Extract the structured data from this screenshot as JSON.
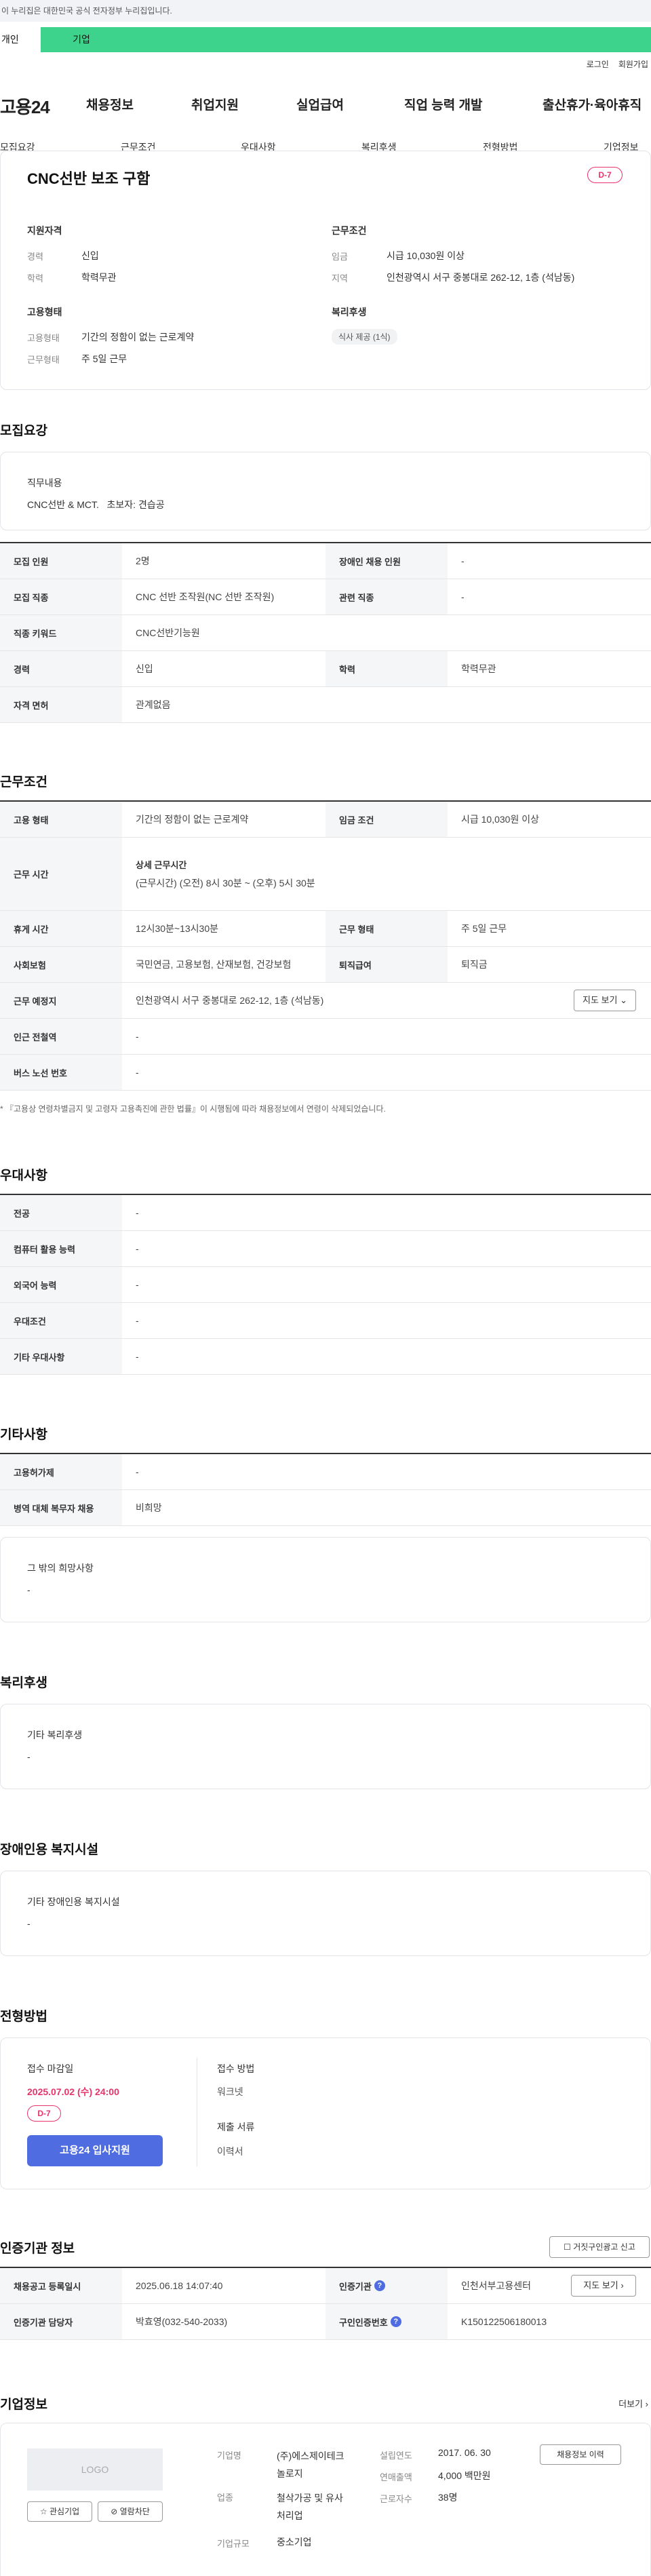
{
  "topbar": {
    "notice": "이 누리집은 대한민국 공식 전자정부 누리집입니다."
  },
  "usertabs": {
    "individual": "개인",
    "company": "기업"
  },
  "util": {
    "login": "로그인",
    "join": "회원가입"
  },
  "header": {
    "logo": "고용24",
    "gnb": [
      "채용정보",
      "취업지원",
      "실업급여",
      "직업 능력 개발",
      "출산휴가·육아휴직"
    ]
  },
  "subnav": [
    "모집요강",
    "근무조건",
    "우대사항",
    "복리후생",
    "전형방법",
    "기업정보"
  ],
  "summary": {
    "title": "CNC선반 보조 구함",
    "dday": "D-7",
    "qual_title": "지원자격",
    "cond_title": "근무조건",
    "qual": [
      {
        "label": "경력",
        "value": "신입"
      },
      {
        "label": "학력",
        "value": "학력무관"
      }
    ],
    "cond": [
      {
        "label": "임금",
        "value": "시급 10,030원 이상"
      },
      {
        "label": "지역",
        "value": "인천광역시 서구 중봉대로 262-12, 1층 (석남동)"
      }
    ],
    "emp_title": "고용형태",
    "welfare_title": "복리후생",
    "emp": [
      {
        "label": "고용형태",
        "value": "기간의 정함이 없는 근로계약"
      },
      {
        "label": "근무형태",
        "value": "주 5일 근무"
      }
    ],
    "welfare_chip": "식사 제공 (1식)"
  },
  "recruit": {
    "title": "모집요강",
    "duty_label": "직무내용",
    "duty_value": "CNC선반 & MCT.   초보자: 견습공",
    "rows": [
      {
        "h1": "모집 인원",
        "v1": "2명",
        "h2": "장애인 채용 인원",
        "v2": "-"
      },
      {
        "h1": "모집 직종",
        "v1": "CNC 선반 조작원(NC 선반 조작원)",
        "h2": "관련 직종",
        "v2": "-"
      },
      {
        "h1": "직종 키워드",
        "v1": "CNC선반기능원"
      },
      {
        "h1": "경력",
        "v1": "신입",
        "h2": "학력",
        "v2": "학력무관"
      },
      {
        "h1": "자격 면허",
        "v1": "관계없음"
      }
    ]
  },
  "work": {
    "title": "근무조건",
    "emp_h": "고용 형태",
    "emp_v": "기간의 정함이 없는 근로계약",
    "wage_h": "임금 조건",
    "wage_v": "시급 10,030원 이상",
    "time_h": "근무 시간",
    "time_sub": "상세 근무시간",
    "time_v": "(근무시간) (오전) 8시 30분 ~ (오후) 5시 30분",
    "rest_h": "휴게 시간",
    "rest_v": "12시30분~13시30분",
    "form_h": "근무 형태",
    "form_v": "주 5일 근무",
    "ins_h": "사회보험",
    "ins_v": "국민연금, 고용보험, 산재보험, 건강보험",
    "ret_h": "퇴직급여",
    "ret_v": "퇴직금",
    "place_h": "근무 예정지",
    "place_v": "인천광역시 서구 중봉대로 262-12, 1층 (석남동)",
    "map_btn": "지도 보기",
    "sub_h": "인근 전철역",
    "sub_v": "-",
    "bus_h": "버스 노선 번호",
    "bus_v": "-",
    "note": "* 『고용상 연령차별금지 및 고령자 고용촉진에 관한 법률』이 시행됨에 따라 채용정보에서 연령이 삭제되었습니다."
  },
  "pref": {
    "title": "우대사항",
    "rows": [
      {
        "h": "전공",
        "v": "-"
      },
      {
        "h": "컴퓨터 활용 능력",
        "v": "-"
      },
      {
        "h": "외국어 능력",
        "v": "-"
      },
      {
        "h": "우대조건",
        "v": "-"
      },
      {
        "h": "기타 우대사항",
        "v": "-"
      }
    ]
  },
  "etc": {
    "title": "기타사항",
    "rows": [
      {
        "h": "고용허가제",
        "v": "-"
      },
      {
        "h": "병역 대체 복무자 채용",
        "v": "비희망"
      }
    ],
    "hope_label": "그 밖의 희망사항",
    "hope_value": "-"
  },
  "welfare": {
    "title": "복리후생",
    "label": "기타 복리후생",
    "value": "-"
  },
  "disabled": {
    "title": "장애인용 복지시설",
    "label": "기타 장애인용 복지시설",
    "value": "-"
  },
  "process": {
    "title": "전형방법",
    "deadline_label": "접수 마감일",
    "deadline": "2025.07.02 (수) 24:00",
    "dday": "D-7",
    "apply_btn": "고용24 입사지원",
    "method_label": "접수 방법",
    "method": "워크넷",
    "docs_label": "제출 서류",
    "docs": "이력서"
  },
  "cert": {
    "title": "인증기관 정보",
    "report_btn": "거짓구인광고 신고",
    "reg_h": "채용공고 등록일시",
    "reg_v": "2025.06.18 14:07:40",
    "org_h": "인증기관",
    "org_v": "인천서부고용센터",
    "map_btn": "지도 보기",
    "mgr_h": "인증기관 담당자",
    "mgr_v": "박효영(032-540-2033)",
    "num_h": "구인인증번호",
    "num_v": "K150122506180013"
  },
  "company": {
    "title": "기업정보",
    "more": "더보기",
    "logo_text": "LOGO",
    "fav_btn": "관심기업",
    "block_btn": "열람차단",
    "history_btn": "채용정보 이력",
    "name_l": "기업명",
    "name_v": "(주)에스제이테크놀로지",
    "ind_l": "업종",
    "ind_v": "철삭가공 및 유사 처리업",
    "size_l": "기업규모",
    "size_v": "중소기업",
    "year_l": "설립연도",
    "year_v": "2017. 06. 30",
    "sales_l": "연매출액",
    "sales_v": "4,000 백만원",
    "emp_l": "근로자수",
    "emp_v": "38명"
  }
}
